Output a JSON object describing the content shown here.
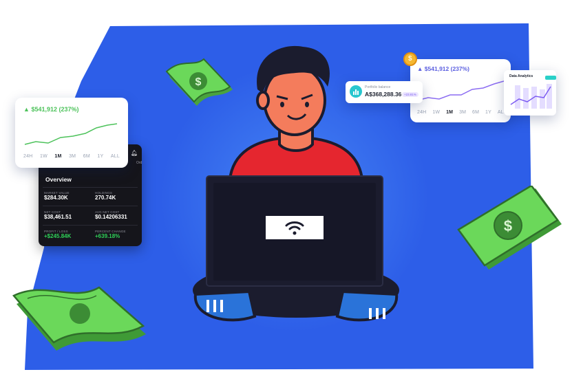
{
  "colors": {
    "blob": "#2d5ee8",
    "accent_green": "#4cc25a",
    "chart_purple": "#8b6cf2",
    "laptop": "#1b1c2e",
    "shirt": "#e5262f",
    "skin": "#f47c5c",
    "money": "#5fcf54"
  },
  "left_card": {
    "value_text": "$541,912 (237%)",
    "tabs": [
      "24H",
      "1W",
      "1M",
      "3M",
      "6M",
      "1Y",
      "ALL"
    ],
    "active_tab": "1M"
  },
  "dark_panel": {
    "title": "Overview",
    "peek_text": "Ord",
    "stats": [
      {
        "label": "MARKET VALUE",
        "value": "$284.30K"
      },
      {
        "label": "HOLDINGS",
        "value": "270.74K"
      },
      {
        "label": "NET COST",
        "value": "$38,461.51"
      },
      {
        "label": "AVG NET COST",
        "value": "$0.14206331"
      },
      {
        "label": "PROFIT / LOSS",
        "value": "+$245.84K"
      },
      {
        "label": "PERCENT CHANGE",
        "value": "+639.18%"
      }
    ]
  },
  "right_card": {
    "value_text": "$541,912 (237%)",
    "tabs": [
      "24H",
      "1W",
      "1M",
      "3M",
      "6M",
      "1Y",
      "ALL"
    ],
    "active_tab": "1M"
  },
  "portfolio_pill": {
    "label": "Portfolio balance",
    "value": "A$368,288.36",
    "badge": "+23.81%"
  },
  "analytics_card": {
    "title": "Data Analytics"
  },
  "laptop": {
    "icon": "wifi-icon"
  },
  "icons": [
    "bell-icon",
    "up-triangle-icon",
    "coin-icon",
    "dollar-bill-icon",
    "wifi-icon"
  ]
}
